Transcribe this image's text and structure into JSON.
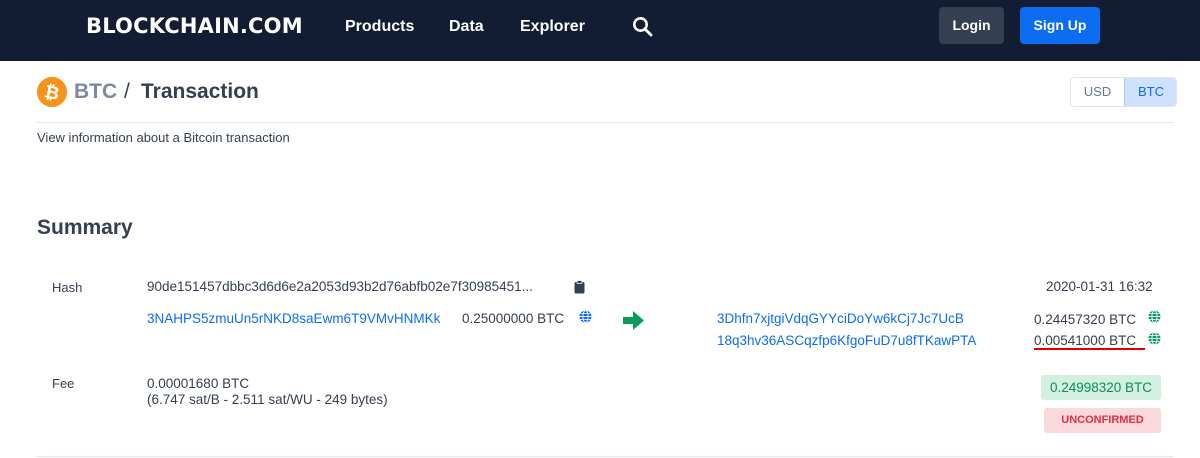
{
  "nav": {
    "logo": "BLOCKCHAIN.COM",
    "links": [
      "Products",
      "Data",
      "Explorer"
    ],
    "search_icon": "search-icon",
    "login": "Login",
    "signup": "Sign Up"
  },
  "header": {
    "coin_icon": "bitcoin-icon",
    "coin": "BTC",
    "separator": "/",
    "title": "Transaction",
    "subtitle": "View information about a Bitcoin transaction",
    "currency_options": [
      "USD",
      "BTC"
    ],
    "currency_selected": "BTC"
  },
  "summary": {
    "heading": "Summary",
    "hash_label": "Hash",
    "hash": "90de151457dbbc3d6d6e2a2053d93b2d76abfb02e7f30985451...",
    "copy_icon": "clipboard-icon",
    "timestamp": "2020-01-31 16:32",
    "input": {
      "address": "3NAHPS5zmuUn5rNKD8saEwm6T9VMvHNMKk",
      "amount": "0.25000000 BTC"
    },
    "arrow_icon": "arrow-right-icon",
    "outputs": [
      {
        "address": "3Dhfn7xjtgiVdqGYYciDoYw6kCj7Jc7UcB",
        "amount": "0.24457320 BTC"
      },
      {
        "address": "18q3hv36ASCqzfp6KfgoFuD7u8fTKawPTA",
        "amount": "0.00541000 BTC"
      }
    ],
    "fee_label": "Fee",
    "fee_btc": "0.00001680 BTC",
    "fee_detail": "(6.747 sat/B - 2.511 sat/WU - 249 bytes)",
    "total": "0.24998320 BTC",
    "status": "UNCONFIRMED"
  },
  "colors": {
    "nav_bg": "#121d33",
    "accent_blue": "#0c6cf2",
    "bitcoin_orange": "#f7931a",
    "confirm_green": "#0a8f56",
    "unconfirmed_red": "#e0303f",
    "underline_red": "#e00000"
  }
}
